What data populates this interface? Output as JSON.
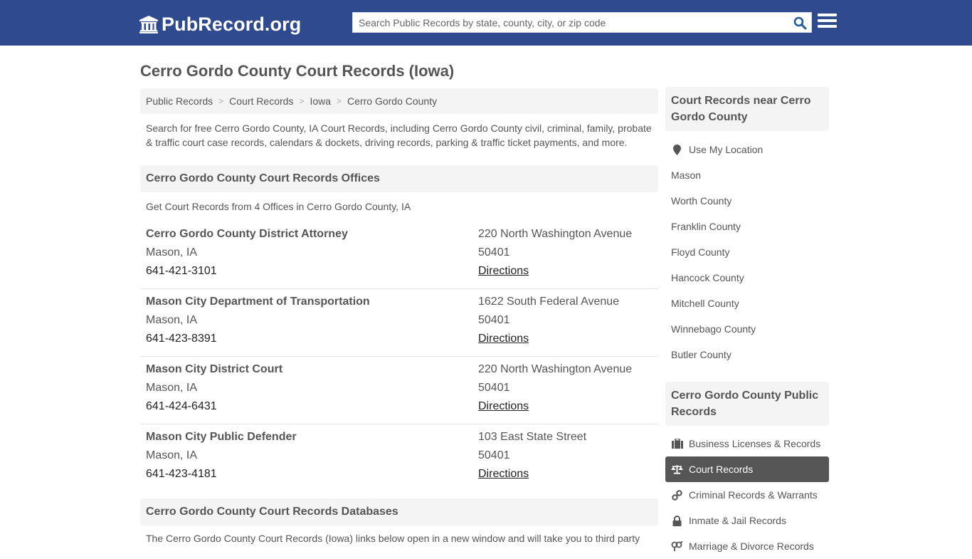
{
  "header": {
    "logo_text": "PubRecord.org",
    "search_placeholder": "Search Public Records by state, county, city, or zip code",
    "search_value": ""
  },
  "page": {
    "title": "Cerro Gordo County Court Records (Iowa)",
    "breadcrumb": [
      "Public Records",
      "Court Records",
      "Iowa",
      "Cerro Gordo County"
    ],
    "breadcrumb_separator": ">",
    "intro": "Search for free Cerro Gordo County, IA Court Records, including Cerro Gordo County civil, criminal, family, probate & traffic court case records, calendars & dockets, driving records, parking & traffic ticket payments, and more."
  },
  "offices_section": {
    "title": "Cerro Gordo County Court Records Offices",
    "subtitle": "Get Court Records from 4 Offices in Cerro Gordo County, IA",
    "offices": [
      {
        "name": "Cerro Gordo County District Attorney",
        "city": "Mason, IA",
        "phone": "641-421-3101",
        "address": "220 North Washington Avenue",
        "zip": "50401",
        "directions": "Directions"
      },
      {
        "name": "Mason City Department of Transportation",
        "city": "Mason, IA",
        "phone": "641-423-8391",
        "address": "1622 South Federal Avenue",
        "zip": "50401",
        "directions": "Directions"
      },
      {
        "name": "Mason City District Court",
        "city": "Mason, IA",
        "phone": "641-424-6431",
        "address": "220 North Washington Avenue",
        "zip": "50401",
        "directions": "Directions"
      },
      {
        "name": "Mason City Public Defender",
        "city": "Mason, IA",
        "phone": "641-423-4181",
        "address": "103 East State Street",
        "zip": "50401",
        "directions": "Directions"
      }
    ]
  },
  "databases_section": {
    "title": "Cerro Gordo County Court Records Databases",
    "text": "The Cerro Gordo County Court Records (Iowa) links below open in a new window and will take you to third party"
  },
  "sidebar": {
    "nearby": {
      "title": "Court Records near Cerro Gordo County",
      "use_location": {
        "label": "Use My Location",
        "icon": "map-marker-icon"
      },
      "items": [
        "Mason",
        "Worth County",
        "Franklin County",
        "Floyd County",
        "Hancock County",
        "Mitchell County",
        "Winnebago County",
        "Butler County"
      ]
    },
    "public_records": {
      "title": "Cerro Gordo County Public Records",
      "items": [
        {
          "label": "Business Licenses & Records",
          "icon": "briefcase-icon",
          "active": false
        },
        {
          "label": "Court Records",
          "icon": "balance-scale-icon",
          "active": true
        },
        {
          "label": "Criminal Records & Warrants",
          "icon": "handcuffs-icon",
          "active": false
        },
        {
          "label": "Inmate & Jail Records",
          "icon": "lock-icon",
          "active": false
        },
        {
          "label": "Marriage & Divorce Records",
          "icon": "venus-mars-icon",
          "active": false
        }
      ]
    }
  },
  "colors": {
    "header_bg": "#2f4a8f",
    "panel_bg": "#f4f4f4",
    "active_item_bg": "#555555",
    "search_icon": "#1f5a9c"
  }
}
